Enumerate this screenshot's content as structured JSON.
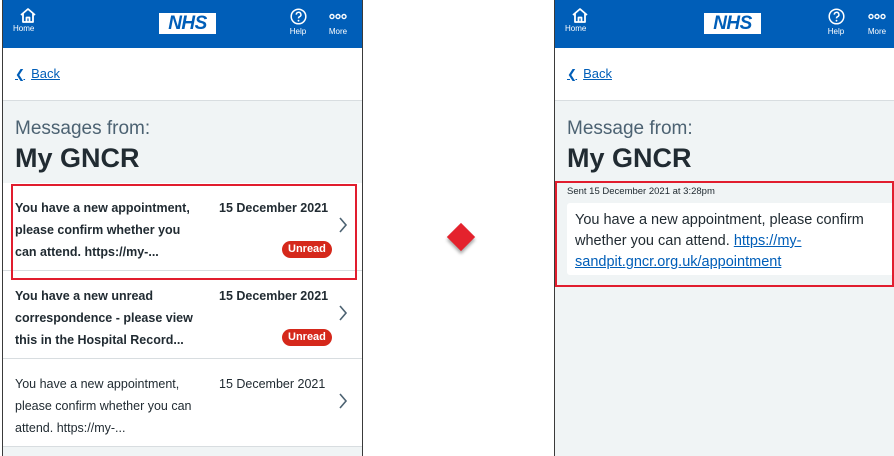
{
  "header": {
    "home_label": "Home",
    "logo_text": "NHS",
    "help_label": "Help",
    "more_label": "More"
  },
  "back_label": "Back",
  "list_view": {
    "title_small": "Messages from:",
    "title_large": "My GNCR",
    "messages": [
      {
        "text": "You have a new appointment, please confirm whether you can attend. https://my-...",
        "date": "15 December 2021",
        "badge": "Unread"
      },
      {
        "text": "You have a new unread correspondence - please view this in the Hospital Record...",
        "date": "15 December 2021",
        "badge": "Unread"
      },
      {
        "text": "You have a new appointment, please confirm whether you can attend. https://my-...",
        "date": "15 December 2021",
        "badge": ""
      }
    ]
  },
  "detail_view": {
    "title_small": "Message from:",
    "title_large": "My GNCR",
    "sent": "Sent 15 December 2021 at 3:28pm",
    "body": "You have a new appointment, please confirm whether you can attend. ",
    "link": "https://my-sandpit.gncr.org.uk/appointment"
  },
  "colors": {
    "header_blue": "#005eb8",
    "unread_red": "#d5281b",
    "highlight_red": "#e11d2e",
    "background": "#f0f4f5"
  }
}
